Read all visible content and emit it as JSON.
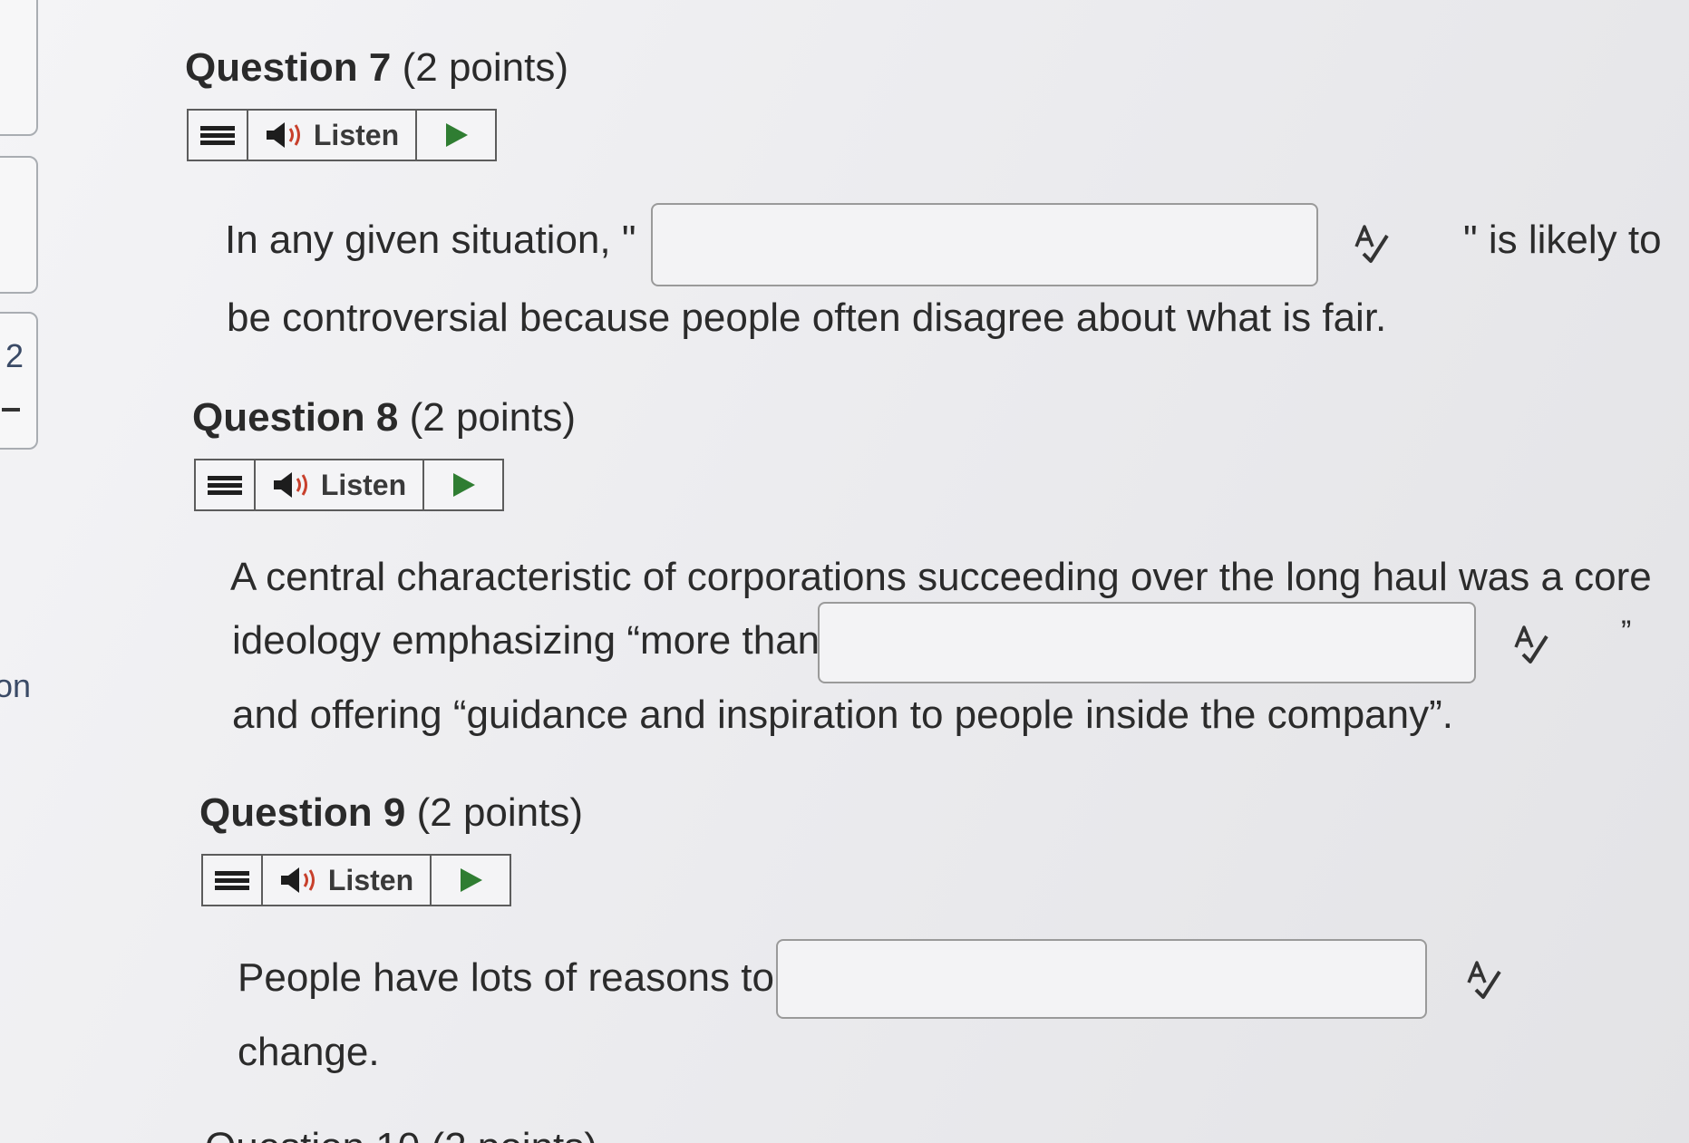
{
  "sidebar": {
    "card3_number": "2",
    "fragment_text": "on"
  },
  "questions": [
    {
      "title": "Question 7",
      "points": "(2 points)",
      "listen_label": "Listen",
      "text_before": "In any given situation, \"",
      "text_after": "\" is likely to",
      "text_line2": "be controversial because people often disagree about what is fair.",
      "answer_value": ""
    },
    {
      "title": "Question 8",
      "points": "(2 points)",
      "listen_label": "Listen",
      "text_line1": "A central characteristic of corporations succeeding over the long haul was a core",
      "text_before": "ideology emphasizing “more than",
      "text_after": "”",
      "text_line3": "and offering “guidance and inspiration to people inside the company”.",
      "answer_value": ""
    },
    {
      "title": "Question 9",
      "points": "(2 points)",
      "listen_label": "Listen",
      "text_before": "People have lots of reasons to",
      "text_line2": "change.",
      "answer_value": ""
    }
  ],
  "next_question_partial": "Question 10 (2 points)",
  "colors": {
    "play_green": "#2f7d32",
    "speaker_dark": "#1d1d1d",
    "speaker_wave": "#c8402c"
  },
  "icons": {
    "menu": "menu-icon",
    "speaker": "speaker-icon",
    "play": "play-icon",
    "spellcheck": "spellcheck-icon"
  }
}
